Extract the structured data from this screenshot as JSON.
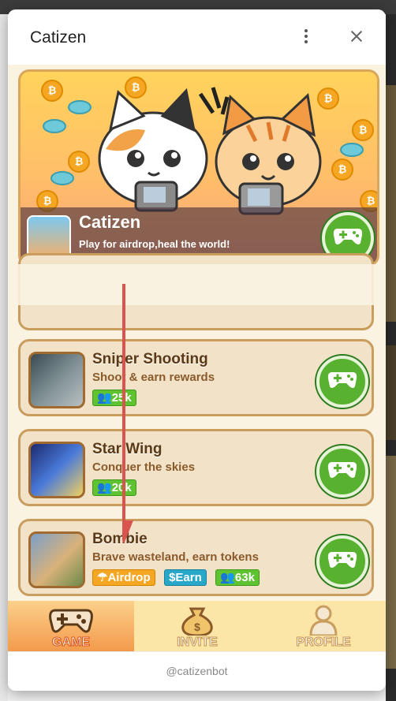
{
  "window": {
    "title": "Catizen"
  },
  "banner": {
    "name": "Catizen",
    "tagline": "Play for airdrop,heal the world!"
  },
  "games": [
    {
      "name": "Sniper Shooting",
      "desc": "Shoot & earn rewards",
      "players": "25k"
    },
    {
      "name": "Star Wing",
      "desc": "Conquer the skies",
      "players": "20k"
    },
    {
      "name": "Bombie",
      "desc": "Brave wasteland, earn tokens",
      "airdrop": "Airdrop",
      "earn": "Earn",
      "players": "63k"
    }
  ],
  "nav": [
    {
      "label": "GAME",
      "active": true
    },
    {
      "label": "INVITE",
      "active": false
    },
    {
      "label": "PROFILE",
      "active": false
    }
  ],
  "footer": {
    "bot": "@catizenbot"
  },
  "icons": {
    "kebab": "more-vertical-icon",
    "close": "close-icon",
    "play": "gamepad-icon",
    "players": "users-icon",
    "airdrop": "parachute-icon",
    "earn": "dollar-icon"
  },
  "colors": {
    "accent": "#58b12f",
    "card": "#f2e3c8",
    "card_border": "#c99d5e",
    "annotation_arrow": "#d9534f"
  }
}
